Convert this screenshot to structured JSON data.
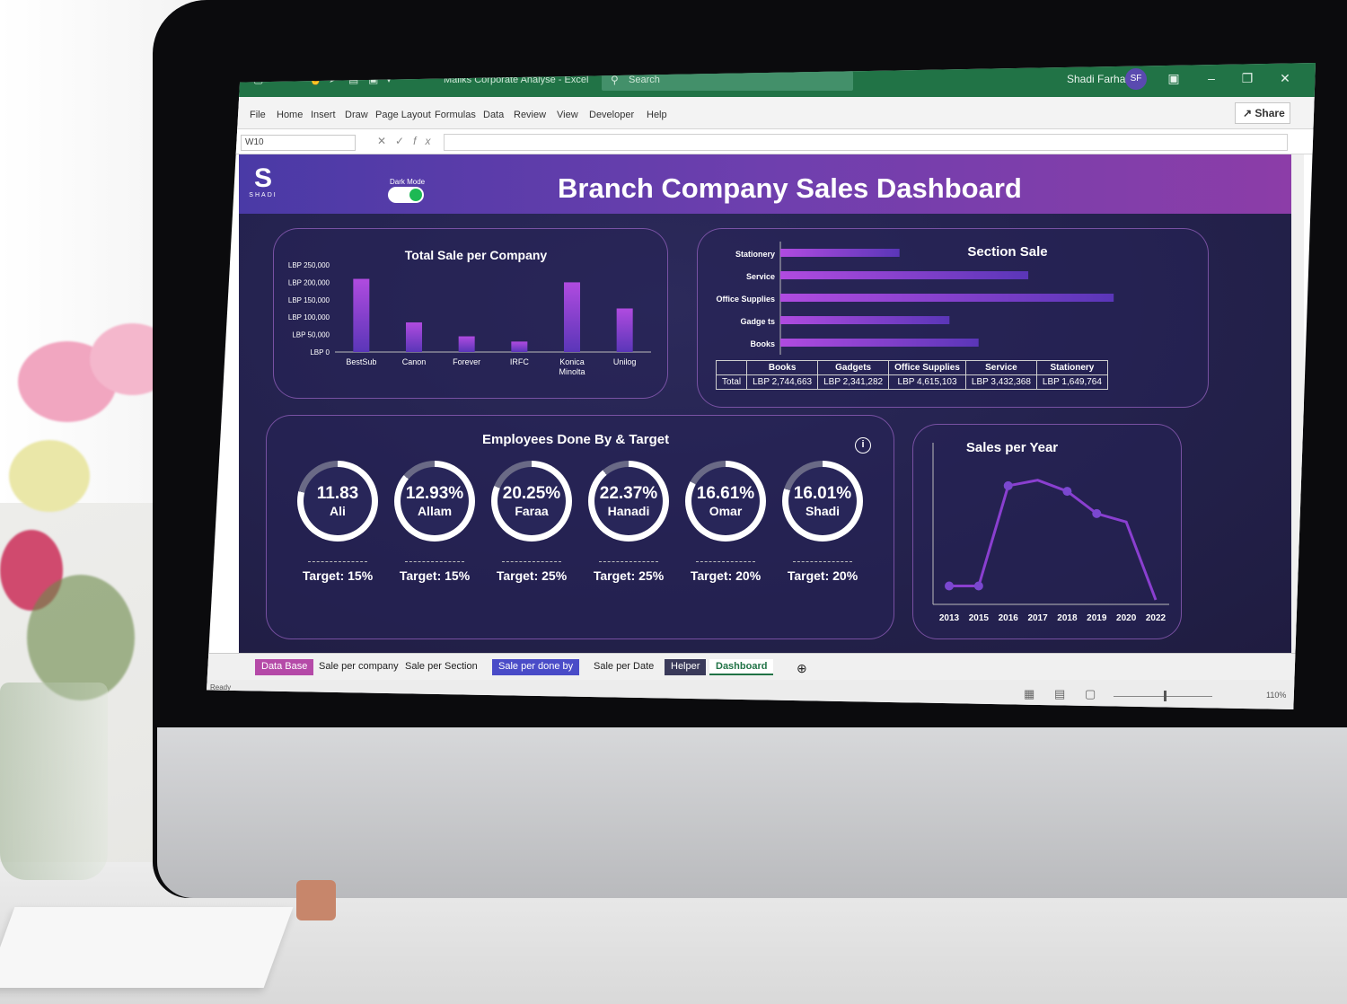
{
  "excel": {
    "doc_title": "Maliks Corporate Analyse  -  Excel",
    "search_placeholder": "Search",
    "user_name": "Shadi Farhat",
    "user_initials": "SF",
    "share_label": "Share",
    "name_box_value": "W10",
    "ribbon_tabs": [
      "File",
      "Home",
      "Insert",
      "Draw",
      "Page Layout",
      "Formulas",
      "Data",
      "Review",
      "View",
      "Developer",
      "Help"
    ],
    "sheet_tabs": [
      "Data Base",
      "Sale per company",
      "Sale per Section",
      "Sale per done by",
      "Sale per Date",
      "Helper",
      "Dashboard"
    ],
    "active_sheet": "Dashboard",
    "status_text": "Ready",
    "zoom_level": "110%",
    "accent_color": "#217346"
  },
  "dashboard": {
    "logo_text": "SHADI",
    "dark_mode_label": "Dark Mode",
    "dark_mode_on": true,
    "title": "Branch Company Sales Dashboard",
    "employees_title": "Employees Done By & Target",
    "employees": [
      {
        "value": "11.83",
        "name": "Ali",
        "target": "Target: 15%",
        "fill": 0.79
      },
      {
        "value": "12.93%",
        "name": "Allam",
        "target": "Target: 15%",
        "fill": 0.86
      },
      {
        "value": "20.25%",
        "name": "Faraa",
        "target": "Target: 25%",
        "fill": 0.81
      },
      {
        "value": "22.37%",
        "name": "Hanadi",
        "target": "Target: 25%",
        "fill": 0.89
      },
      {
        "value": "16.61%",
        "name": "Omar",
        "target": "Target: 20%",
        "fill": 0.83
      },
      {
        "value": "16.01%",
        "name": "Shadi",
        "target": "Target: 20%",
        "fill": 0.8
      }
    ],
    "section_table": {
      "row_label": "Total",
      "headers": [
        "Books",
        "Gadgets",
        "Office Supplies",
        "Service",
        "Stationery"
      ],
      "values": [
        "LBP 2,744,663",
        "LBP 2,341,282",
        "LBP 4,615,103",
        "LBP 3,432,368",
        "LBP 1,649,764"
      ]
    }
  },
  "chart_data": [
    {
      "type": "bar",
      "title": "Total Sale per Company",
      "categories": [
        "BestSub",
        "Canon",
        "Forever",
        "IRFC",
        "Konica Minolta",
        "Unilog"
      ],
      "values": [
        210000,
        85000,
        45000,
        30000,
        200000,
        125000
      ],
      "ytick_labels": [
        "LBP 250,000",
        "LBP 200,000",
        "LBP 150,000",
        "LBP 100,000",
        "LBP 50,000",
        "LBP 0"
      ],
      "ylim": [
        0,
        250000
      ],
      "color": "#8a3fd0"
    },
    {
      "type": "bar",
      "orientation": "horizontal",
      "title": "Section Sale",
      "categories": [
        "Stationery",
        "Service",
        "Office Supplies",
        "Gadge ts",
        "Books"
      ],
      "values": [
        1649764,
        3432368,
        4615103,
        2341282,
        2744663
      ],
      "xlim": [
        0,
        4700000
      ],
      "color": "#8a3fd0"
    },
    {
      "type": "line",
      "title": "Sales per Year",
      "x": [
        "2013",
        "2015",
        "2016",
        "2017",
        "2018",
        "2019",
        "2020",
        "2022"
      ],
      "y": [
        5,
        5,
        41,
        43,
        39,
        31,
        28,
        0
      ],
      "ylim": [
        0,
        50
      ],
      "color": "#8a3fd0"
    }
  ]
}
